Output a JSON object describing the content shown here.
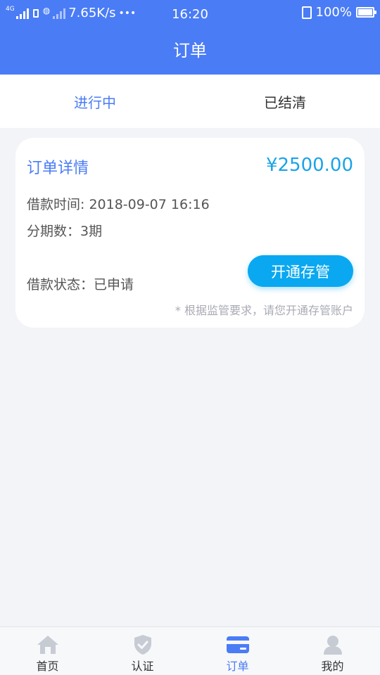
{
  "status_bar": {
    "network_tag": "4G",
    "speed": "7.65K/s",
    "dots": "•••",
    "time": "16:20",
    "battery": "100%"
  },
  "header": {
    "title": "订单"
  },
  "tabs": [
    {
      "label": "进行中",
      "active": true
    },
    {
      "label": "已结清",
      "active": false
    }
  ],
  "order_card": {
    "title": "订单详情",
    "amount": "¥2500.00",
    "loan_time": "借款时间: 2018-09-07 16:16",
    "installments": "分期数：3期",
    "loan_status": "借款状态：已申请",
    "open_button": "开通存管",
    "note": "* 根据监管要求，请您开通存管账户"
  },
  "bottom_nav": [
    {
      "label": "首页",
      "icon": "home-icon",
      "active": false
    },
    {
      "label": "认证",
      "icon": "shield-check-icon",
      "active": false
    },
    {
      "label": "订单",
      "icon": "card-icon",
      "active": true
    },
    {
      "label": "我的",
      "icon": "user-icon",
      "active": false
    }
  ],
  "colors": {
    "primary": "#4a7cf5",
    "amount": "#1aa3e8",
    "button": "#0aa8f0",
    "nav_inactive": "#c7cbd3"
  }
}
